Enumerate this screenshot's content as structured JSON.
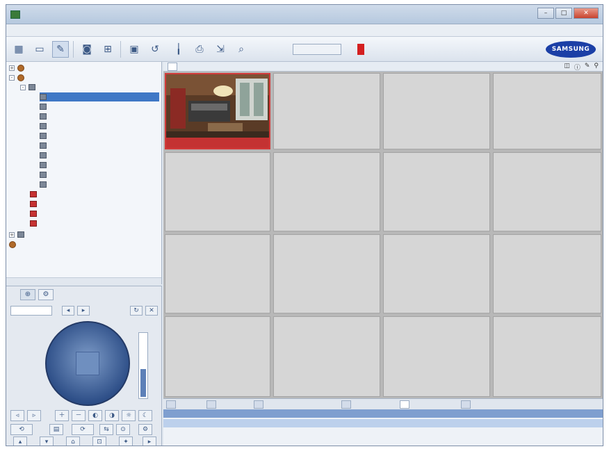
{
  "window": {
    "title": "",
    "min": "–",
    "max": "□",
    "close": "✕"
  },
  "menu": [],
  "toolbar": {
    "info_line1": "",
    "info_line2_label": "",
    "info_line2_value": "",
    "user_line1": "",
    "user_line2": "",
    "brand": "SAMSUNG"
  },
  "tree": {
    "rows": []
  },
  "ptz": {
    "slider_level": 0.45
  },
  "grid": {
    "header_tab": "",
    "cells": [
      "",
      "",
      "",
      "",
      "",
      "",
      "",
      "",
      "",
      "",
      "",
      "",
      "",
      "",
      "",
      ""
    ],
    "live_caption": ""
  },
  "events": {
    "tabs": [
      "",
      "",
      "",
      "",
      "",
      ""
    ],
    "headers": [
      "",
      "",
      "",
      "",
      ""
    ],
    "row": [
      "",
      "",
      ""
    ]
  },
  "colors": {
    "accent": "#3f78c6",
    "record": "#d42020",
    "live_border": "#d23a3a"
  }
}
